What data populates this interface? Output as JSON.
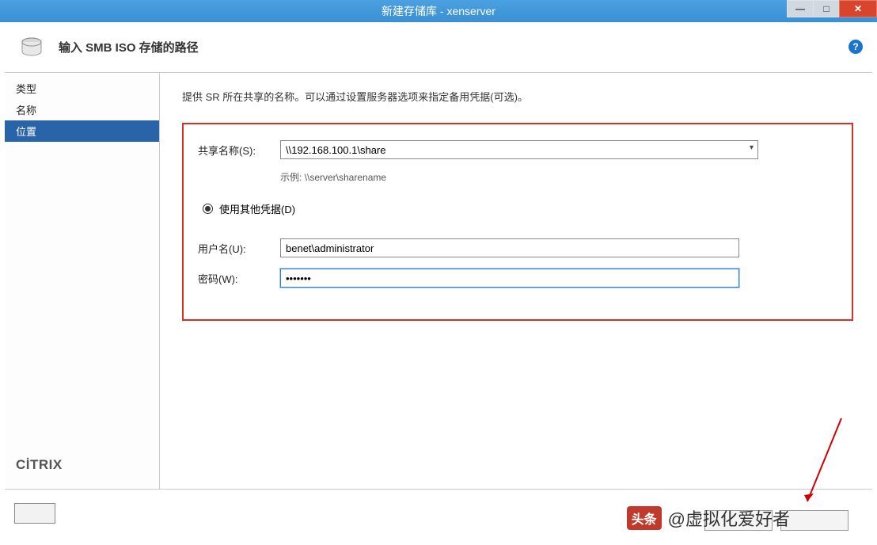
{
  "window": {
    "title": "新建存储库 - xenserver"
  },
  "header": {
    "title": "输入 SMB ISO 存储的路径"
  },
  "sidebar": {
    "items": [
      {
        "label": "类型"
      },
      {
        "label": "名称"
      },
      {
        "label": "位置"
      }
    ],
    "brand": "CİTRIX"
  },
  "main": {
    "instruction": "提供 SR 所在共享的名称。可以通过设置服务器选项来指定备用凭据(可选)。",
    "share_label": "共享名称(S):",
    "share_value": "\\\\192.168.100.1\\share",
    "example_label": "示例: \\\\server\\sharename",
    "radio_label": "使用其他凭据(D)",
    "username_label": "用户名(U):",
    "username_value": "benet\\administrator",
    "password_label": "密码(W):",
    "password_value": "•••••••"
  },
  "footer": {
    "buttons": [
      "",
      ""
    ]
  },
  "watermark": {
    "logo": "头条",
    "text": "@虚拟化爱好者"
  }
}
